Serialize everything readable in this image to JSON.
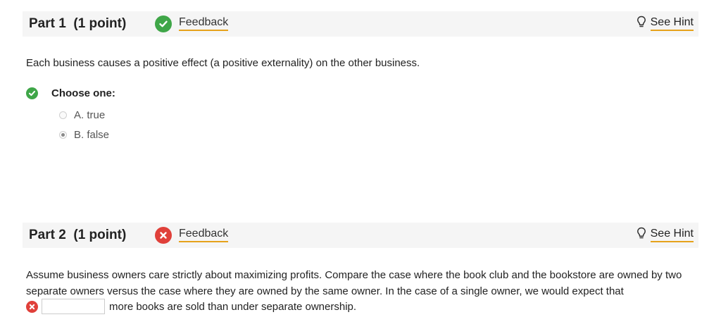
{
  "part1": {
    "title": "Part 1",
    "points": "(1 point)",
    "status": "correct",
    "feedback_label": "Feedback",
    "hint_label": "See Hint",
    "question": "Each business causes a positive effect (a positive externality) on the other business.",
    "choose_label": "Choose one:",
    "options": [
      {
        "label": "A. true",
        "selected": false
      },
      {
        "label": "B. false",
        "selected": true
      }
    ]
  },
  "part2": {
    "title": "Part 2",
    "points": "(1 point)",
    "status": "incorrect",
    "feedback_label": "Feedback",
    "hint_label": "See Hint",
    "question": "Assume business owners care strictly about maximizing profits. Compare the case where the book club and the bookstore are owned by two separate owners versus the case where they are owned by the same owner. In the case of a single owner, we would expect that",
    "answer_value": "",
    "answer_suffix": "more books are sold than under separate ownership."
  },
  "colors": {
    "correct": "#3fa648",
    "incorrect": "#e0403a",
    "link_underline": "#e6a21b",
    "header_bg": "#f5f5f5"
  },
  "icons": {
    "correct": "check-circle-icon",
    "incorrect": "x-circle-icon",
    "hint": "lightbulb-icon"
  }
}
